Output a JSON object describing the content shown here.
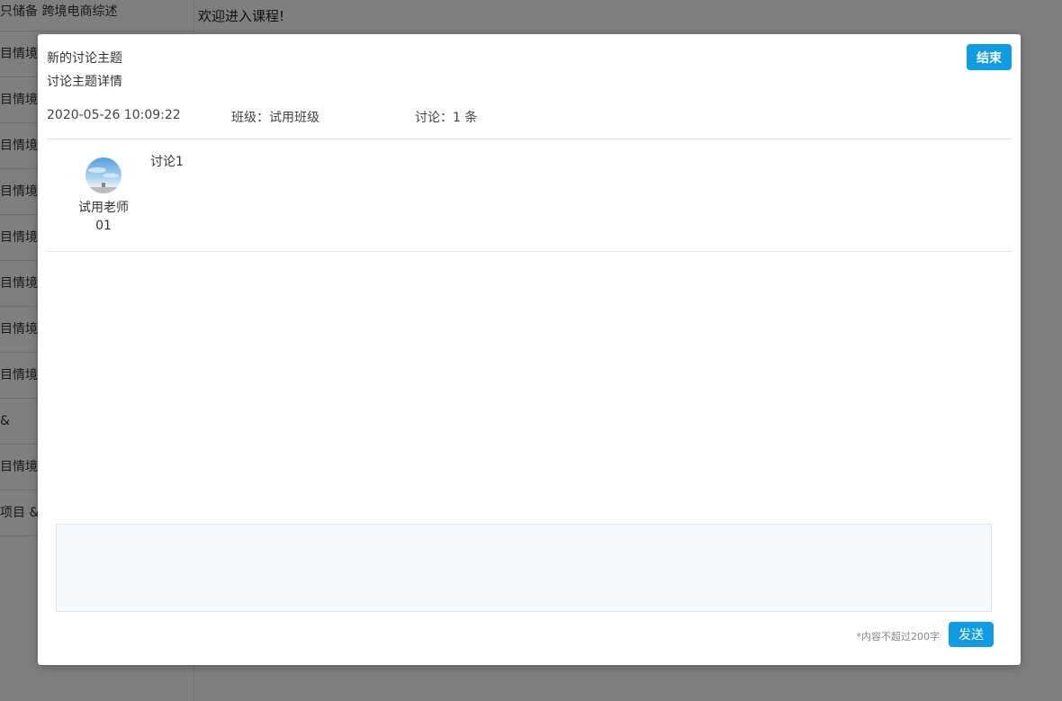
{
  "background": {
    "welcome": "欢迎进入课程!",
    "sidebar_items": [
      "只储备 跨境电商综述",
      "目情境",
      "目情境",
      "目情境",
      "目情境",
      "目情境",
      "目情境",
      "目情境",
      "目情境",
      "&",
      "目情境",
      "项目 &"
    ]
  },
  "modal": {
    "topic_title": "新的讨论主题",
    "topic_detail": "讨论主题详情",
    "end_label": "结束",
    "date": "2020-05-26 10:09:22",
    "class_label": "班级：试用班级",
    "discussion_count": "讨论：1 条",
    "post": {
      "author": "试用老师01",
      "content": "讨论1"
    },
    "reply": {
      "placeholder": "",
      "hint": "*内容不超过200字",
      "send_label": "发送"
    }
  },
  "colors": {
    "accent": "#0e9ce4",
    "overlay": "rgba(0,0,0,0.5)"
  }
}
